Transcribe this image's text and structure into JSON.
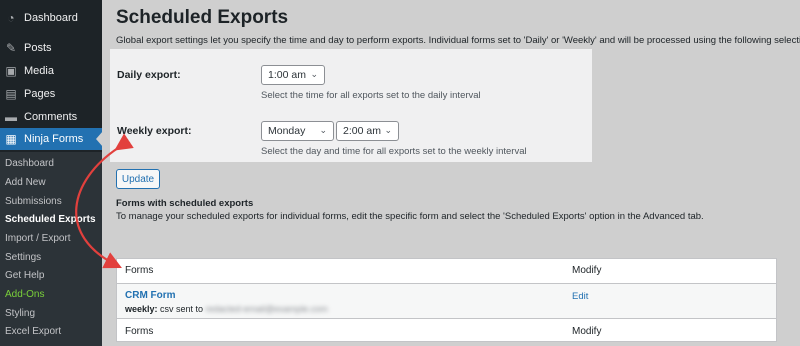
{
  "sidebar": {
    "items": [
      {
        "label": "Dashboard",
        "icon": "dashboard-icon",
        "glyph": "◔"
      },
      {
        "label": "Posts",
        "icon": "pin-icon",
        "glyph": "✎"
      },
      {
        "label": "Media",
        "icon": "media-icon",
        "glyph": "▣"
      },
      {
        "label": "Pages",
        "icon": "pages-icon",
        "glyph": "▤"
      },
      {
        "label": "Comments",
        "icon": "comments-icon",
        "glyph": "▬"
      },
      {
        "label": "Ninja Forms",
        "icon": "ninja-forms-icon",
        "glyph": "▦"
      }
    ],
    "submenu": [
      "Dashboard",
      "Add New",
      "Submissions",
      "Scheduled Exports",
      "Import / Export",
      "Settings",
      "Get Help",
      "Add-Ons",
      "Styling",
      "Excel Export"
    ]
  },
  "page": {
    "title": "Scheduled Exports",
    "description": "Global export settings let you specify the time and day to perform exports. Individual forms set to 'Daily' or 'Weekly' and will be processed using the following selections."
  },
  "daily": {
    "label": "Daily export:",
    "time": "1:00 am",
    "help": "Select the time for all exports set to the daily interval"
  },
  "weekly": {
    "label": "Weekly export:",
    "day": "Monday",
    "time": "2:00 am",
    "help": "Select the day and time for all exports set to the weekly interval"
  },
  "update_button": "Update",
  "forms_section": {
    "title": "Forms with scheduled exports",
    "description": "To manage your scheduled exports for individual forms, edit the specific form and select the 'Scheduled Exports' option in the Advanced tab."
  },
  "table": {
    "col_forms": "Forms",
    "col_modify": "Modify",
    "rows": [
      {
        "name": "CRM Form",
        "interval": "weekly:",
        "sent_text": "csv sent to",
        "redacted": "redacted-email@example.com",
        "action": "Edit"
      }
    ]
  },
  "colors": {
    "sidebar_bg": "#1d2327",
    "accent": "#2271b1",
    "arrow": "#e2403d",
    "addons": "#7ad03a"
  }
}
